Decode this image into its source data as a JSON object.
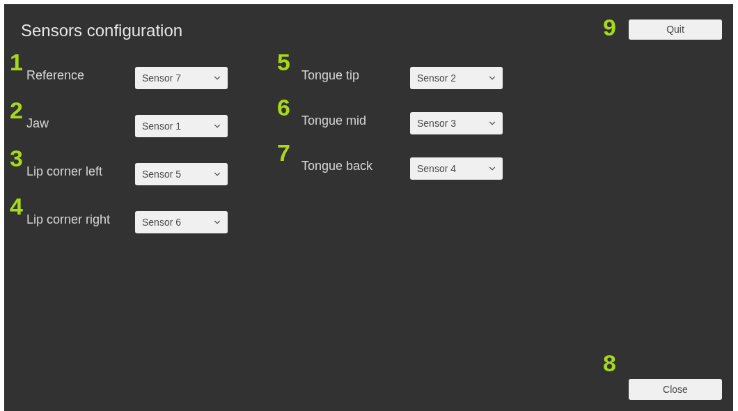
{
  "title": "Sensors configuration",
  "quit": {
    "number": "9",
    "label": "Quit"
  },
  "close": {
    "number": "8",
    "label": "Close"
  },
  "sensors": {
    "left": [
      {
        "number": "1",
        "label": "Reference",
        "value": "Sensor 7"
      },
      {
        "number": "2",
        "label": "Jaw",
        "value": "Sensor 1"
      },
      {
        "number": "3",
        "label": "Lip corner left",
        "value": "Sensor 5"
      },
      {
        "number": "4",
        "label": "Lip corner right",
        "value": "Sensor 6"
      }
    ],
    "right": [
      {
        "number": "5",
        "label": "Tongue tip",
        "value": "Sensor 2"
      },
      {
        "number": "6",
        "label": "Tongue mid",
        "value": "Sensor 3"
      },
      {
        "number": "7",
        "label": "Tongue back",
        "value": "Sensor 4"
      }
    ]
  }
}
